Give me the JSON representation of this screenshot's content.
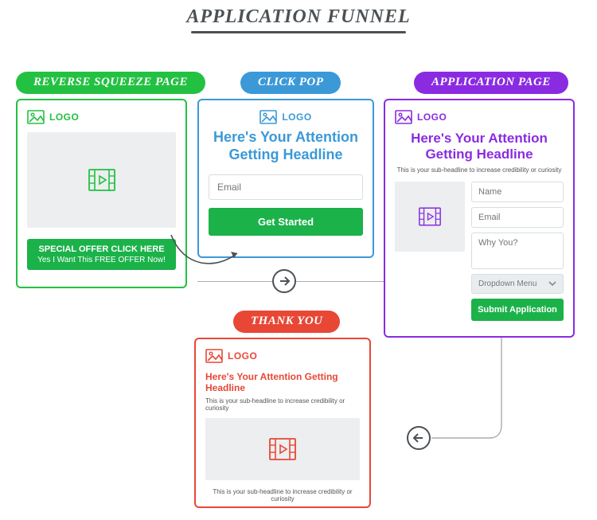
{
  "title": "APPLICATION FUNNEL",
  "pills": {
    "reverse_squeeze": "REVERSE SQUEEZE PAGE",
    "click_pop": "CLICK POP",
    "application_page": "APPLICATION PAGE",
    "thank_you": "THANK YOU"
  },
  "cards": {
    "reverse_squeeze": {
      "logo": "LOGO",
      "cta_line1": "SPECIAL OFFER CLICK HERE",
      "cta_line2": "Yes I Want This FREE OFFER Now!"
    },
    "click_pop": {
      "logo": "LOGO",
      "headline": "Here's Your Attention Getting Headline",
      "email_placeholder": "Email",
      "cta": "Get Started"
    },
    "application": {
      "logo": "LOGO",
      "headline": "Here's Your Attention Getting Headline",
      "subhead": "This is your sub-headline to increase credibility or curiosity",
      "name_placeholder": "Name",
      "email_placeholder": "Email",
      "why_placeholder": "Why You?",
      "dropdown": "Dropdown Menu",
      "cta": "Submit Application"
    },
    "thank_you": {
      "logo": "LOGO",
      "headline": "Here's Your Attention Getting Headline",
      "subhead": "This is your sub-headline to increase credibility or curiosity",
      "footer": "This is your sub-headline to increase credibility or curiosity"
    }
  },
  "colors": {
    "green": "#23c142",
    "blue": "#3b99d8",
    "purple": "#8a2be2",
    "red": "#e84736"
  }
}
